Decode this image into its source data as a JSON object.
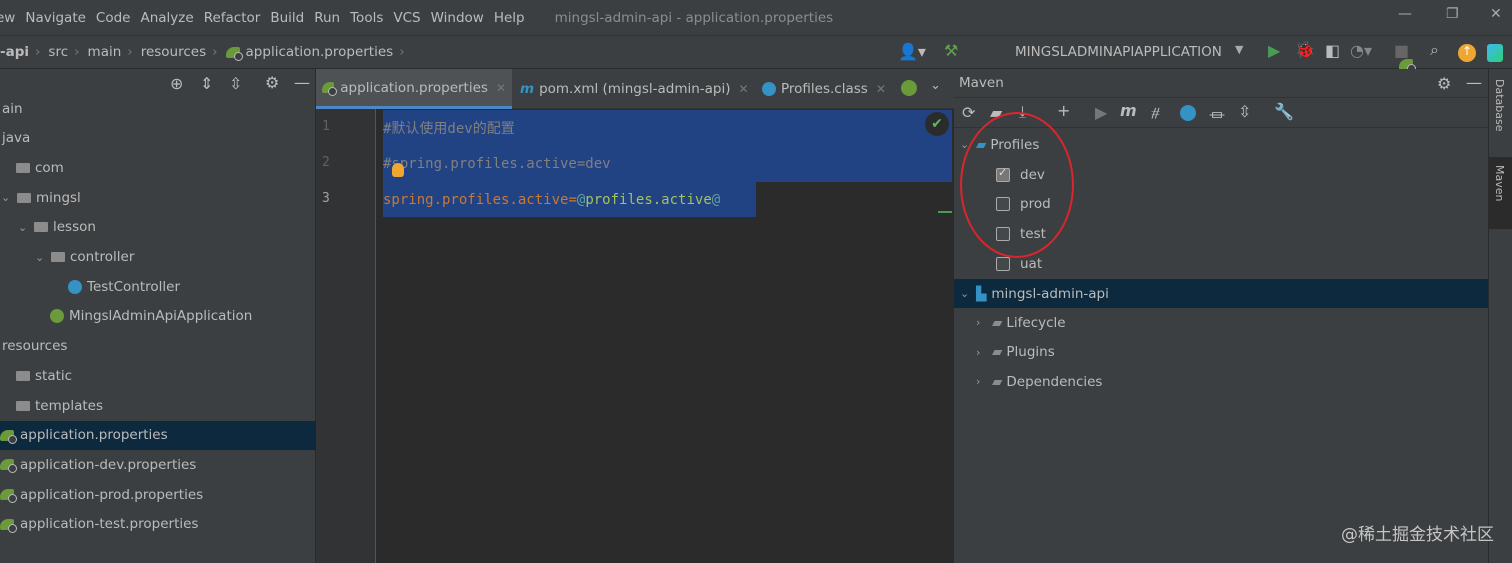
{
  "menu": [
    "ew",
    "Navigate",
    "Code",
    "Analyze",
    "Refactor",
    "Build",
    "Run",
    "Tools",
    "VCS",
    "Window",
    "Help"
  ],
  "window_title": "mingsl-admin-api - application.properties",
  "breadcrumb": [
    "-api",
    "src",
    "main",
    "resources",
    "application.properties"
  ],
  "run_config": "MINGSLADMINAPIAPPLICATION",
  "tree": [
    {
      "label": "ain",
      "indent": 0,
      "kind": "text"
    },
    {
      "label": "java",
      "indent": 0,
      "kind": "text"
    },
    {
      "label": "com",
      "indent": 0,
      "kind": "folder"
    },
    {
      "label": "mingsl",
      "indent": 1,
      "kind": "folder"
    },
    {
      "label": "lesson",
      "indent": 2,
      "kind": "folder"
    },
    {
      "label": "controller",
      "indent": 3,
      "kind": "folder"
    },
    {
      "label": "TestController",
      "indent": 4,
      "kind": "class"
    },
    {
      "label": "MingslAdminApiApplication",
      "indent": 3,
      "kind": "spring"
    },
    {
      "label": "resources",
      "indent": 0,
      "kind": "text"
    },
    {
      "label": "static",
      "indent": 0,
      "kind": "folder"
    },
    {
      "label": "templates",
      "indent": 0,
      "kind": "folder"
    },
    {
      "label": "application.properties",
      "indent": 0,
      "kind": "leaf",
      "selected": true
    },
    {
      "label": "application-dev.properties",
      "indent": 0,
      "kind": "leaf"
    },
    {
      "label": "application-prod.properties",
      "indent": 0,
      "kind": "leaf"
    },
    {
      "label": "application-test.properties",
      "indent": 0,
      "kind": "leaf"
    }
  ],
  "tabs": [
    "application.properties",
    "pom.xml (mingsl-admin-api)",
    "Profiles.class"
  ],
  "code": {
    "line_numbers": [
      "1",
      "2",
      "3"
    ],
    "line1": "#默认使用dev的配置",
    "line2": "#spring.profiles.active=dev",
    "line3_key": "spring.profiles.active",
    "line3_eq": "=",
    "line3_at1": "@",
    "line3_val": "profiles.active",
    "line3_at2": "@"
  },
  "maven": {
    "title": "Maven",
    "profiles_label": "Profiles",
    "profiles": [
      {
        "name": "dev",
        "checked": true
      },
      {
        "name": "prod",
        "checked": false
      },
      {
        "name": "test",
        "checked": false
      },
      {
        "name": "uat",
        "checked": false
      }
    ],
    "project": "mingsl-admin-api",
    "nodes": [
      "Lifecycle",
      "Plugins",
      "Dependencies"
    ]
  },
  "side_tabs": [
    "Database",
    "Maven"
  ],
  "watermark": "@稀土掘金技术社区"
}
